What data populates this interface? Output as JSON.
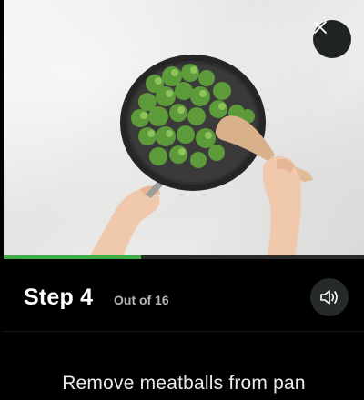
{
  "step": {
    "title": "Step 4",
    "count": "Out of 16",
    "progress_fraction": 0.25
  },
  "instruction": "Remove meatballs from pan",
  "icons": {
    "close": "close-icon",
    "sound": "speaker-icon"
  },
  "colors": {
    "progress": "#3fae49",
    "background": "#000000"
  }
}
